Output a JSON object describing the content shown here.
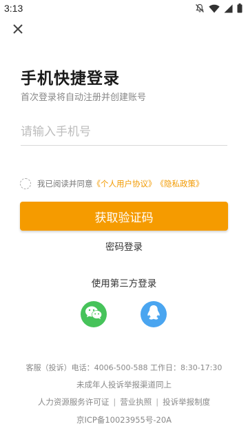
{
  "status_bar": {
    "time": "3:13",
    "icons": [
      "notification-off-icon",
      "wifi-icon",
      "signal-icon",
      "battery-icon"
    ]
  },
  "header": {
    "close_icon": "close-icon"
  },
  "login": {
    "title": "手机快捷登录",
    "subtitle": "首次登录将自动注册并创建账号",
    "phone_placeholder": "请输入手机号",
    "agreement_prefix": "我已阅读并同意",
    "user_agreement": "《个人用户协议》",
    "privacy_policy": "《隐私政策》",
    "get_code_button": "获取验证码",
    "password_login": "密码登录"
  },
  "third_party": {
    "title": "使用第三方登录",
    "providers": [
      "wechat-icon",
      "qq-icon"
    ]
  },
  "footer": {
    "service_line": "客服（投诉）电话：4006-500-588 工作日：8:30-17:30",
    "minor_line": "未成年人投诉举报渠道同上",
    "license": "人力资源服务许可证",
    "business": "营业执照",
    "report": "投诉举报制度",
    "separator": "|",
    "icp": "京ICP备10023955号-20A"
  },
  "colors": {
    "accent": "#f59b00",
    "link": "#f29a00",
    "wechat": "#46c35a",
    "qq": "#4aa5f0"
  }
}
